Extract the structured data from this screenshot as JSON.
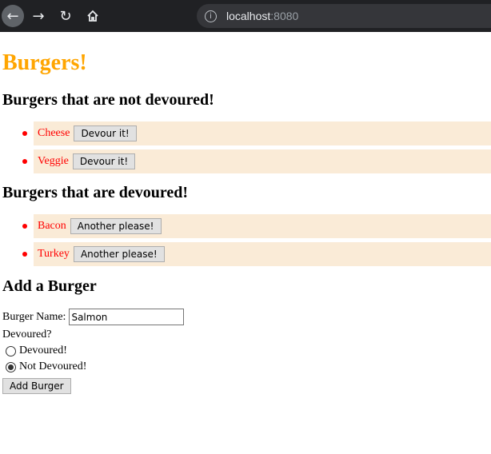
{
  "browser": {
    "url_host": "localhost",
    "url_port": ":8080"
  },
  "page": {
    "title": "Burgers!",
    "not_devoured_heading": "Burgers that are not devoured!",
    "not_devoured": [
      {
        "name": "Cheese",
        "button": "Devour it!"
      },
      {
        "name": "Veggie",
        "button": "Devour it!"
      }
    ],
    "devoured_heading": "Burgers that are devoured!",
    "devoured": [
      {
        "name": "Bacon",
        "button": "Another please!"
      },
      {
        "name": "Turkey",
        "button": "Another please!"
      }
    ],
    "add_heading": "Add a Burger",
    "form": {
      "name_label": "Burger Name:",
      "name_value": "Salmon",
      "devoured_question": "Devoured?",
      "option_devoured": "Devoured!",
      "option_not_devoured": "Not Devoured!",
      "selected_option": "Not Devoured!",
      "submit_label": "Add Burger"
    }
  },
  "colors": {
    "title": "#ffa500",
    "burger_name": "#ff0000",
    "list_item_bg": "#faebd7"
  }
}
